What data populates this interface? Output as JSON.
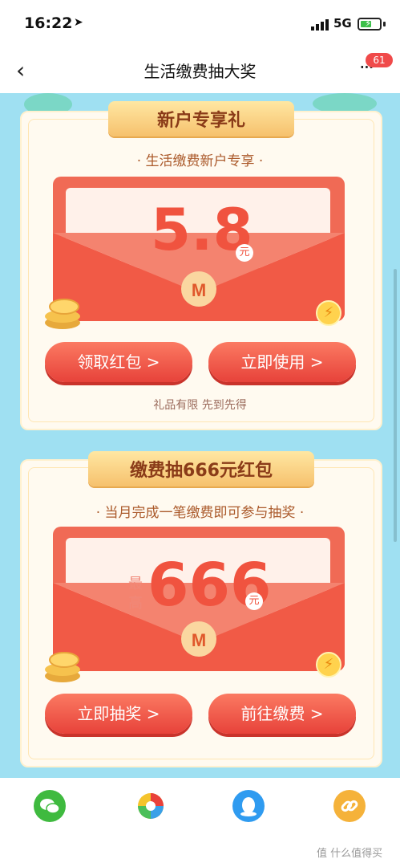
{
  "status_bar": {
    "time": "16:22",
    "network": "5G",
    "battery_level": 0.6
  },
  "nav": {
    "title": "生活缴费抽大奖",
    "badge": "61"
  },
  "card1": {
    "ribbon": "新户专享礼",
    "subtitle": "· 生活缴费新户专享 ·",
    "amount": "5.8",
    "unit": "元",
    "btn_left": "领取红包 >",
    "btn_right": "立即使用 >",
    "note": "礼品有限 先到先得"
  },
  "card2": {
    "ribbon": "缴费抽666元红包",
    "subtitle": "· 当月完成一笔缴费即可参与抽奖 ·",
    "prefix": "最高",
    "amount": "666",
    "unit": "元",
    "btn_left": "立即抽奖 >",
    "btn_right": "前往缴费 >"
  },
  "share": {
    "icons": [
      "wechat-icon",
      "moments-icon",
      "qq-icon",
      "link-icon"
    ]
  },
  "watermark": "值 什么值得买",
  "colors": {
    "accent": "#e7423a",
    "bg": "#9fe0f2",
    "ribbon": "#f6c16d"
  }
}
